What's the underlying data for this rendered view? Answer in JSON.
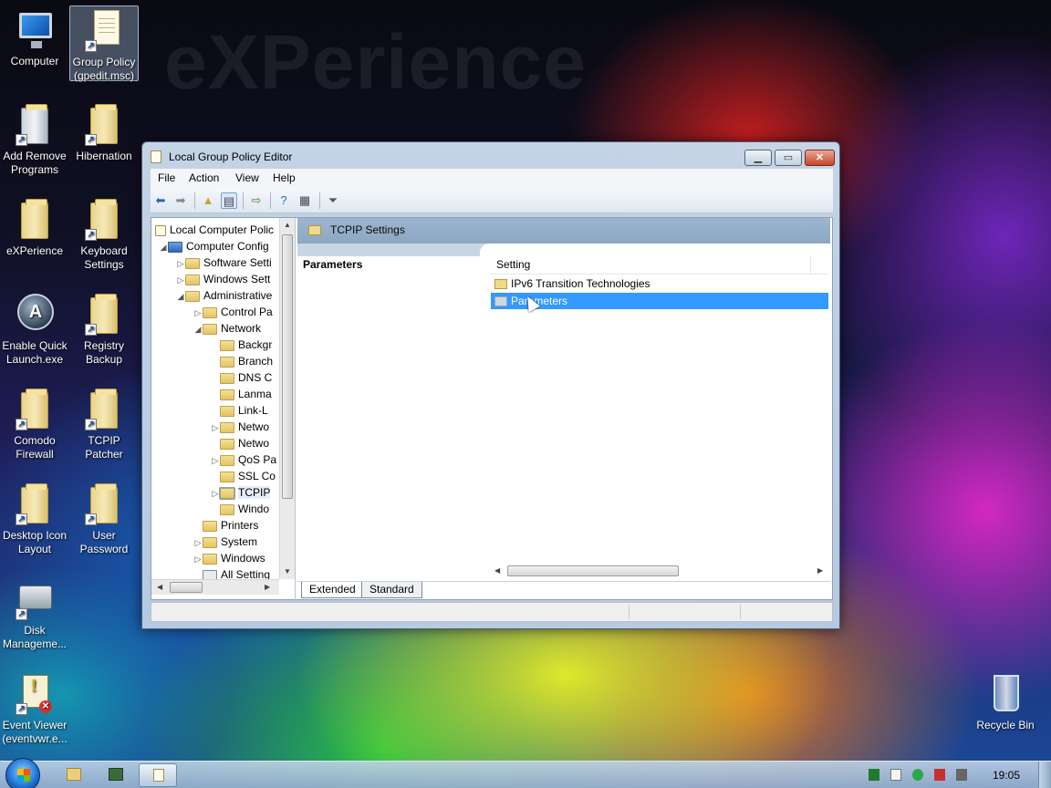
{
  "desktop": {
    "watermark": "eXPerience",
    "icons": [
      {
        "label": "Computer"
      },
      {
        "label": "Group Policy (gpedit.msc)"
      },
      {
        "label": "Add Remove Programs"
      },
      {
        "label": "Hibernation"
      },
      {
        "label": "eXPerience"
      },
      {
        "label": "Keyboard Settings"
      },
      {
        "label": "Enable Quick Launch.exe"
      },
      {
        "label": "Registry Backup"
      },
      {
        "label": "Comodo Firewall"
      },
      {
        "label": "TCPIP Patcher"
      },
      {
        "label": "Desktop Icon Layout"
      },
      {
        "label": "User Password"
      },
      {
        "label": "Disk Manageme..."
      },
      {
        "label": "Event Viewer (eventvwr.e..."
      },
      {
        "label": "Recycle Bin"
      }
    ]
  },
  "window": {
    "title": "Local Group Policy Editor",
    "controls": {
      "minimize": "▁",
      "maximize": "▭",
      "close": "✕"
    },
    "menu": [
      "File",
      "Action",
      "View",
      "Help"
    ],
    "tree": [
      {
        "label": "Local Computer Polic"
      },
      {
        "label": "Computer Config"
      },
      {
        "label": "Software Setti"
      },
      {
        "label": "Windows Sett"
      },
      {
        "label": "Administrative"
      },
      {
        "label": "Control Pa"
      },
      {
        "label": "Network"
      },
      {
        "label": "Backgr"
      },
      {
        "label": "Branch"
      },
      {
        "label": "DNS C"
      },
      {
        "label": "Lanma"
      },
      {
        "label": "Link-L"
      },
      {
        "label": "Netwo"
      },
      {
        "label": "Netwo"
      },
      {
        "label": "QoS Pa"
      },
      {
        "label": "SSL Co"
      },
      {
        "label": "TCPIP"
      },
      {
        "label": "Windo"
      },
      {
        "label": "Printers"
      },
      {
        "label": "System"
      },
      {
        "label": "Windows"
      },
      {
        "label": "All Setting"
      }
    ],
    "right_pane": {
      "header": "TCPIP Settings",
      "description_title": "Parameters",
      "column_header": "Setting",
      "items": [
        {
          "label": "IPv6 Transition Technologies",
          "selected": false
        },
        {
          "label": "Parameters",
          "selected": true
        }
      ],
      "tabs": [
        "Extended",
        "Standard"
      ],
      "active_tab": "Extended"
    }
  },
  "taskbar": {
    "clock": "19:05"
  }
}
